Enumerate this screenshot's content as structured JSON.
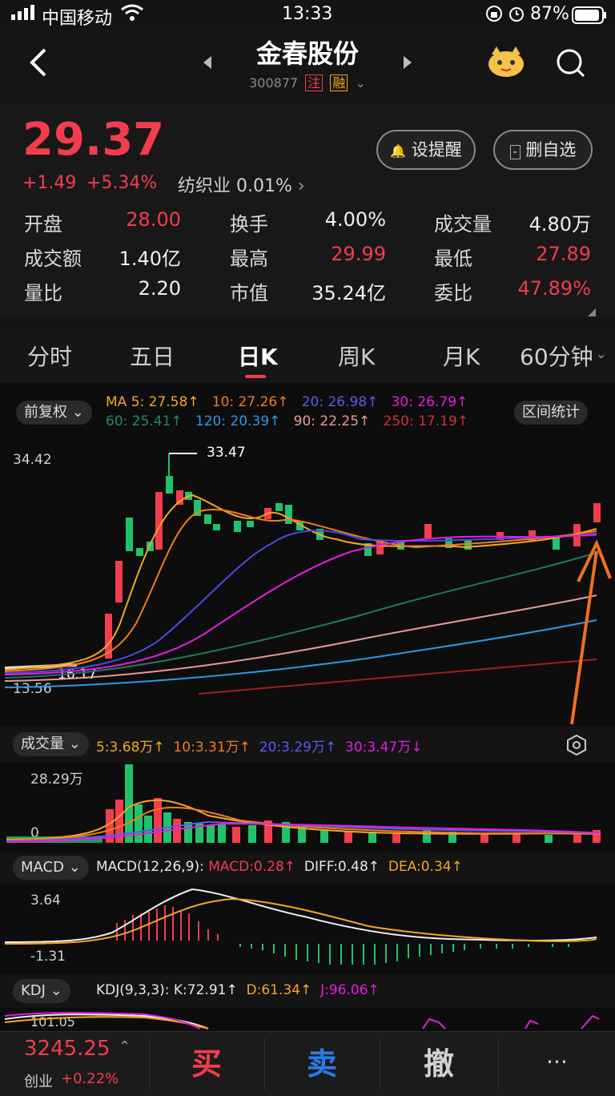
{
  "status": {
    "carrier": "中国移动",
    "time": "13:33",
    "battery": "87%"
  },
  "header": {
    "title": "金春股份",
    "code": "300877",
    "tag1": "注",
    "tag2": "融"
  },
  "quote": {
    "price": "29.37",
    "change": "+1.49",
    "change_pct": "+5.34%",
    "industry": "纺织业",
    "industry_pct": "0.01%",
    "alert_label": "设提醒",
    "remove_label": "删自选",
    "stats": [
      {
        "label": "开盘",
        "value": "28.00"
      },
      {
        "label": "换手",
        "value": "4.00%"
      },
      {
        "label": "成交量",
        "value": "4.80万"
      },
      {
        "label": "成交额",
        "value": "1.40亿"
      },
      {
        "label": "最高",
        "value": "29.99"
      },
      {
        "label": "最低",
        "value": "27.89"
      },
      {
        "label": "量比",
        "value": "2.20"
      },
      {
        "label": "市值",
        "value": "35.24亿"
      },
      {
        "label": "委比",
        "value": "47.89%"
      }
    ]
  },
  "tabs": [
    "分时",
    "五日",
    "日K",
    "周K",
    "月K",
    "60分钟"
  ],
  "kline": {
    "adjust_label": "前复权",
    "range_stat_label": "区间统计",
    "ma_row1": [
      "MA 5: 27.58↑",
      "10: 27.26↑",
      "20: 26.98↑",
      "30: 26.79↑"
    ],
    "ma_row2": [
      "60: 25.41↑",
      "120: 20.39↑",
      "90: 22.25↑",
      "250: 17.19↑"
    ],
    "y_top": "34.42",
    "y_bottom": "13.56",
    "high_label": "33.47",
    "low_label": "16.17"
  },
  "volume": {
    "label": "成交量",
    "ma": [
      "5:3.68万↑",
      "10:3.31万↑",
      "20:3.29万↑",
      "30:3.47万↓"
    ],
    "y_top": "28.29万",
    "y_bottom": "0"
  },
  "macd": {
    "label": "MACD",
    "params": "MACD(12,26,9):",
    "macd": "MACD:0.28↑",
    "diff": "DIFF:0.48↑",
    "dea": "DEA:0.34↑",
    "y_top": "3.64",
    "y_bottom": "-1.31"
  },
  "kdj": {
    "label": "KDJ",
    "params": "KDJ(9,3,3):",
    "k": "K:72.91↑",
    "d": "D:61.34↑",
    "j": "J:96.06↑",
    "y_top": "101.05"
  },
  "footer": {
    "index_value": "3245.25",
    "index_name": "创业",
    "index_pct": "+0.22%",
    "buy": "买",
    "sell": "卖",
    "cancel": "撤",
    "more": "···"
  },
  "colors": {
    "up": "#f23d4c",
    "down": "#1fc46a",
    "ma5": "#f5a623",
    "ma10": "#f07d1a",
    "ma20": "#4a4ae8",
    "ma30": "#e020e0",
    "arrow": "#f07020"
  }
}
